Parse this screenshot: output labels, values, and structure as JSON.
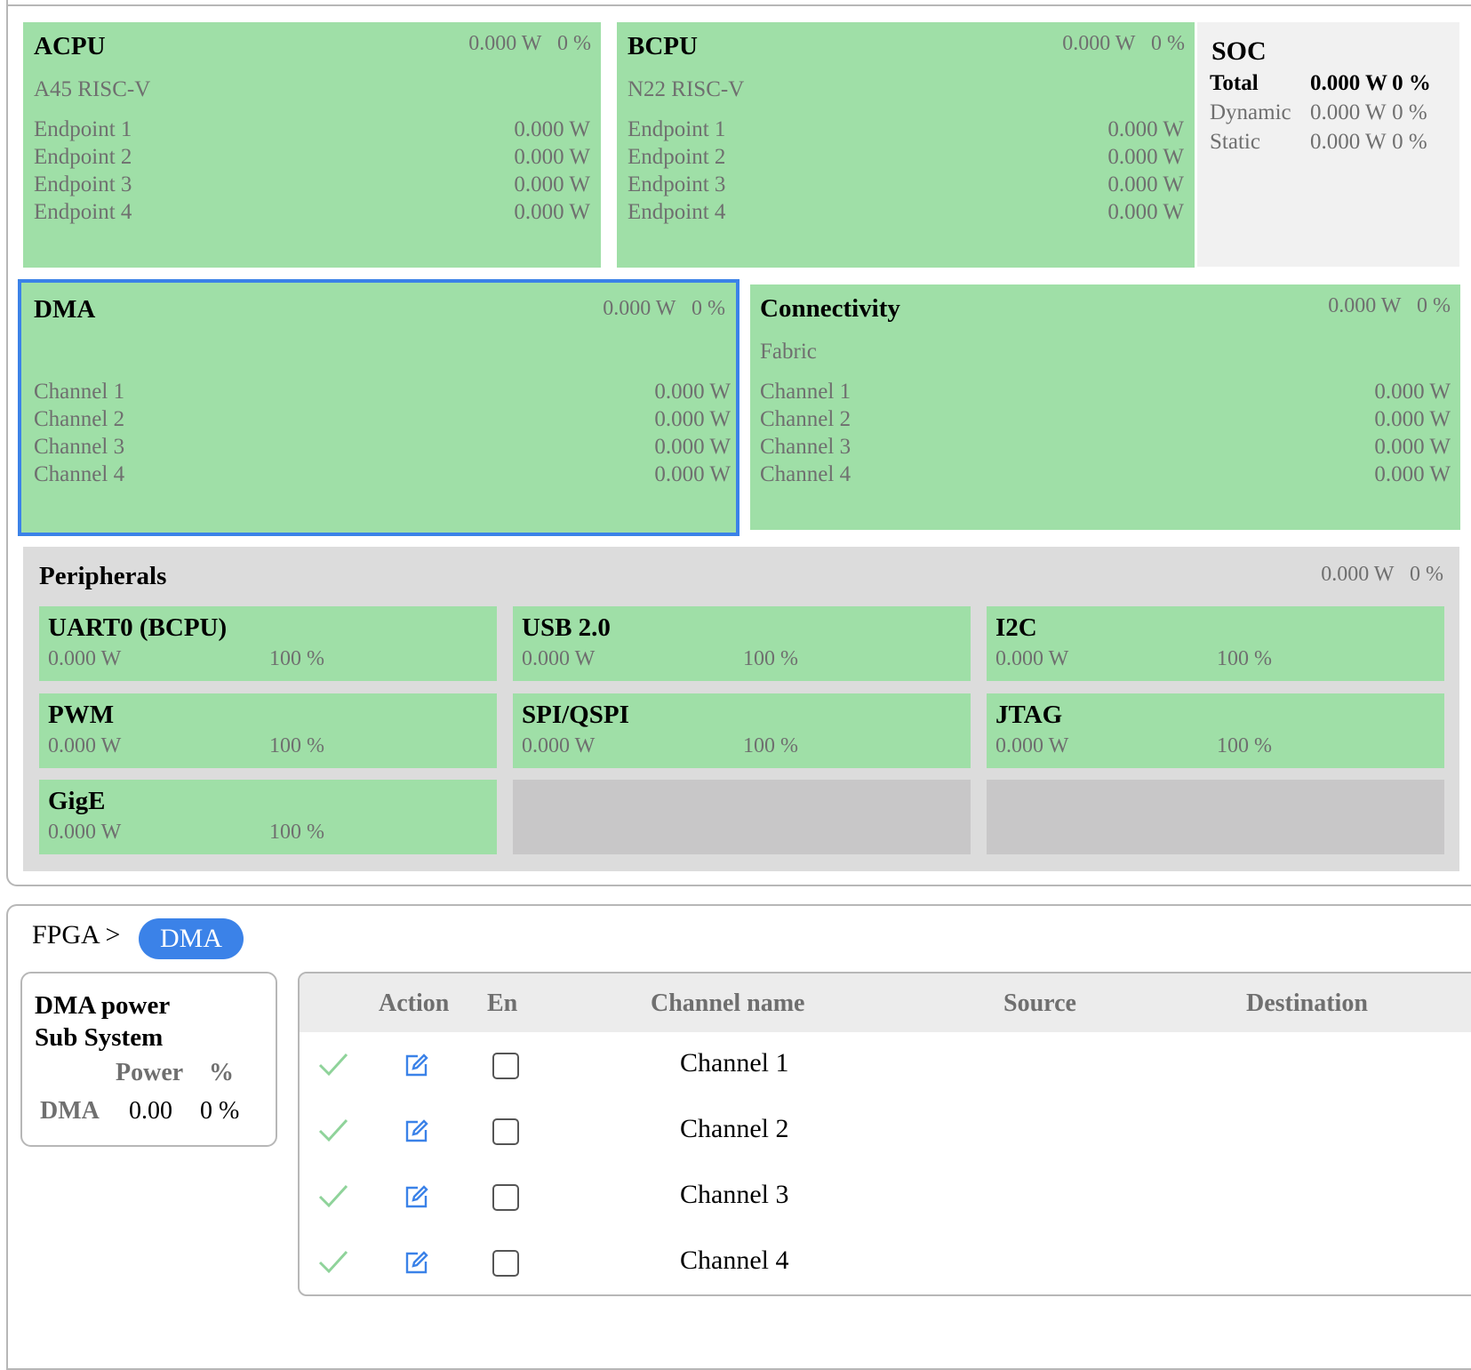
{
  "acpu": {
    "title": "ACPU",
    "power": "0.000 W",
    "pct": "0 %",
    "subtitle": "A45 RISC-V",
    "rows": [
      {
        "label": "Endpoint 1",
        "value": "0.000 W"
      },
      {
        "label": "Endpoint 2",
        "value": "0.000 W"
      },
      {
        "label": "Endpoint 3",
        "value": "0.000 W"
      },
      {
        "label": "Endpoint 4",
        "value": "0.000 W"
      }
    ]
  },
  "bcpu": {
    "title": "BCPU",
    "power": "0.000 W",
    "pct": "0 %",
    "subtitle": "N22 RISC-V",
    "rows": [
      {
        "label": "Endpoint 1",
        "value": "0.000 W"
      },
      {
        "label": "Endpoint 2",
        "value": "0.000 W"
      },
      {
        "label": "Endpoint 3",
        "value": "0.000 W"
      },
      {
        "label": "Endpoint 4",
        "value": "0.000 W"
      }
    ]
  },
  "soc": {
    "title": "SOC",
    "rows": [
      {
        "label": "Total",
        "power": "0.000 W",
        "pct": "0 %"
      },
      {
        "label": "Dynamic",
        "power": "0.000 W",
        "pct": "0 %"
      },
      {
        "label": "Static",
        "power": "0.000 W",
        "pct": "0 %"
      }
    ]
  },
  "dma": {
    "title": "DMA",
    "power": "0.000 W",
    "pct": "0 %",
    "rows": [
      {
        "label": "Channel 1",
        "value": "0.000 W"
      },
      {
        "label": "Channel 2",
        "value": "0.000 W"
      },
      {
        "label": "Channel 3",
        "value": "0.000 W"
      },
      {
        "label": "Channel 4",
        "value": "0.000 W"
      }
    ]
  },
  "connectivity": {
    "title": "Connectivity",
    "power": "0.000 W",
    "pct": "0 %",
    "subtitle": "Fabric",
    "rows": [
      {
        "label": "Channel 1",
        "value": "0.000 W"
      },
      {
        "label": "Channel 2",
        "value": "0.000 W"
      },
      {
        "label": "Channel 3",
        "value": "0.000 W"
      },
      {
        "label": "Channel 4",
        "value": "0.000 W"
      }
    ]
  },
  "peripherals": {
    "title": "Peripherals",
    "power": "0.000 W",
    "pct": "0 %",
    "items": [
      {
        "name": "UART0 (BCPU)",
        "power": "0.000 W",
        "pct": "100 %"
      },
      {
        "name": "USB 2.0",
        "power": "0.000 W",
        "pct": "100 %"
      },
      {
        "name": "I2C",
        "power": "0.000 W",
        "pct": "100 %"
      },
      {
        "name": "PWM",
        "power": "0.000 W",
        "pct": "100 %"
      },
      {
        "name": "SPI/QSPI",
        "power": "0.000 W",
        "pct": "100 %"
      },
      {
        "name": "JTAG",
        "power": "0.000 W",
        "pct": "100 %"
      },
      {
        "name": "GigE",
        "power": "0.000 W",
        "pct": "100 %"
      }
    ]
  },
  "breadcrumb": {
    "root": "FPGA",
    "separator": ">",
    "current": "DMA"
  },
  "dma_power": {
    "title": "DMA power Sub System",
    "power_header": "Power",
    "pct_header": "%",
    "row_label": "DMA",
    "row_power": "0.00",
    "row_pct": "0 %"
  },
  "channel_table": {
    "headers": {
      "action": "Action",
      "en": "En",
      "name": "Channel name",
      "source": "Source",
      "destination": "Destination"
    },
    "rows": [
      {
        "name": "Channel 1",
        "enabled": false
      },
      {
        "name": "Channel 2",
        "enabled": false
      },
      {
        "name": "Channel 3",
        "enabled": false
      },
      {
        "name": "Channel 4",
        "enabled": false
      }
    ]
  },
  "icons": {
    "status": "checkmark-icon",
    "action": "edit-icon"
  },
  "colors": {
    "active_green": "#9fdfa7",
    "selected_border": "#3b82e8",
    "pill_blue": "#3b82e8",
    "check_green": "#8fd39a",
    "edit_blue": "#3b82e8"
  }
}
